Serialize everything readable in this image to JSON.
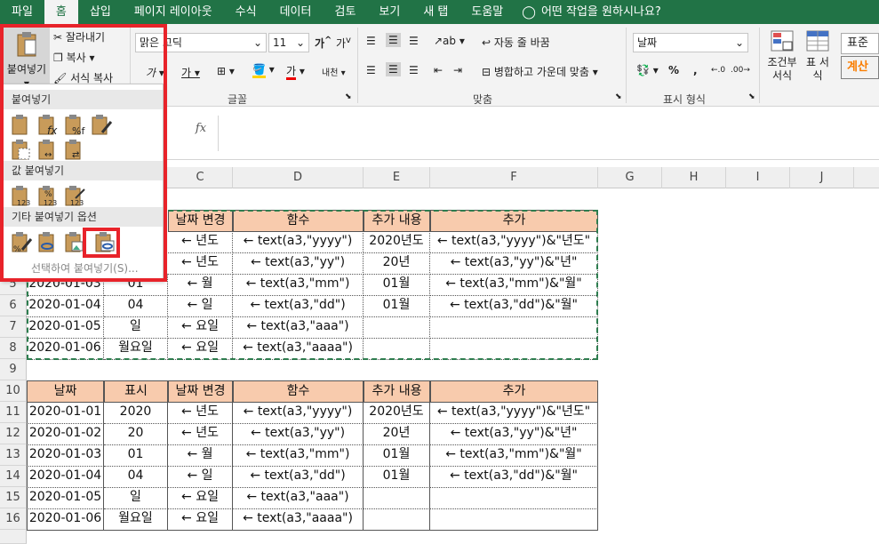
{
  "tabs": [
    "파일",
    "홈",
    "삽입",
    "페이지 레이아웃",
    "수식",
    "데이터",
    "검토",
    "보기",
    "새 탭",
    "도움말",
    "어떤 작업을 원하시나요?"
  ],
  "ribbon": {
    "paste_label": "붙여넣기",
    "cut": "잘라내기",
    "copy": "복사",
    "format_painter": "서식 복사",
    "font_name": "맑은 고딕",
    "font_size": "11",
    "font_group": "글꼴",
    "wrap_text": "자동 줄 바꿈",
    "merge_center": "병합하고 가운데 맞춤",
    "align_group": "맞춤",
    "number_format": "날짜",
    "number_group": "표시 형식",
    "cond_format": "조건부 서식",
    "table_format": "표 서식",
    "style_normal": "표준",
    "style_calc": "계산",
    "percent": "%",
    "comma": ","
  },
  "formula_bar": {
    "fx": "fx"
  },
  "paste_menu": {
    "section1": "붙여넣기",
    "section2": "값 붙여넣기",
    "section3": "기타 붙여넣기 옵션",
    "special": "선택하여 붙여넣기(S)..."
  },
  "columns": [
    "C",
    "D",
    "E",
    "F",
    "G",
    "H",
    "I",
    "J"
  ],
  "rows": [
    "5",
    "6",
    "7",
    "8",
    "9",
    "10",
    "11",
    "12",
    "13",
    "14",
    "15",
    "16"
  ],
  "table_top": {
    "headers": [
      "날짜 변경",
      "함수",
      "추가 내용",
      "추가"
    ],
    "rows": [
      {
        "a": "",
        "b": "",
        "c": "← 년도",
        "d": "← text(a3,\"yyyy\")",
        "e": "2020년도",
        "f": "← text(a3,\"yyyy\")&\"년도\""
      },
      {
        "a": "",
        "b": "",
        "c": "← 년도",
        "d": "← text(a3,\"yy\")",
        "e": "20년",
        "f": "← text(a3,\"yy\")&\"년\""
      },
      {
        "a": "2020-01-03",
        "b": "01",
        "c": "← 월",
        "d": "← text(a3,\"mm\")",
        "e": "01월",
        "f": "← text(a3,\"mm\")&\"월\""
      },
      {
        "a": "2020-01-04",
        "b": "04",
        "c": "← 일",
        "d": "← text(a3,\"dd\")",
        "e": "01월",
        "f": "← text(a3,\"dd\")&\"월\""
      },
      {
        "a": "2020-01-05",
        "b": "일",
        "c": "← 요일",
        "d": "← text(a3,\"aaa\")",
        "e": "",
        "f": ""
      },
      {
        "a": "2020-01-06",
        "b": "월요일",
        "c": "← 요일",
        "d": "← text(a3,\"aaaa\")",
        "e": "",
        "f": ""
      }
    ]
  },
  "table_bottom": {
    "headers": [
      "날짜",
      "표시",
      "날짜 변경",
      "함수",
      "추가 내용",
      "추가"
    ],
    "rows": [
      [
        "2020-01-01",
        "2020",
        "← 년도",
        "← text(a3,\"yyyy\")",
        "2020년도",
        "← text(a3,\"yyyy\")&\"년도\""
      ],
      [
        "2020-01-02",
        "20",
        "← 년도",
        "← text(a3,\"yy\")",
        "20년",
        "← text(a3,\"yy\")&\"년\""
      ],
      [
        "2020-01-03",
        "01",
        "← 월",
        "← text(a3,\"mm\")",
        "01월",
        "← text(a3,\"mm\")&\"월\""
      ],
      [
        "2020-01-04",
        "04",
        "← 일",
        "← text(a3,\"dd\")",
        "01월",
        "← text(a3,\"dd\")&\"월\""
      ],
      [
        "2020-01-05",
        "일",
        "← 요일",
        "← text(a3,\"aaa\")",
        "",
        ""
      ],
      [
        "2020-01-06",
        "월요일",
        "← 요일",
        "← text(a3,\"aaaa\")",
        "",
        ""
      ]
    ]
  },
  "colors": {
    "header_fill": "#f8cbad",
    "ribbon_green": "#217346",
    "highlight_red": "#e8232a"
  }
}
